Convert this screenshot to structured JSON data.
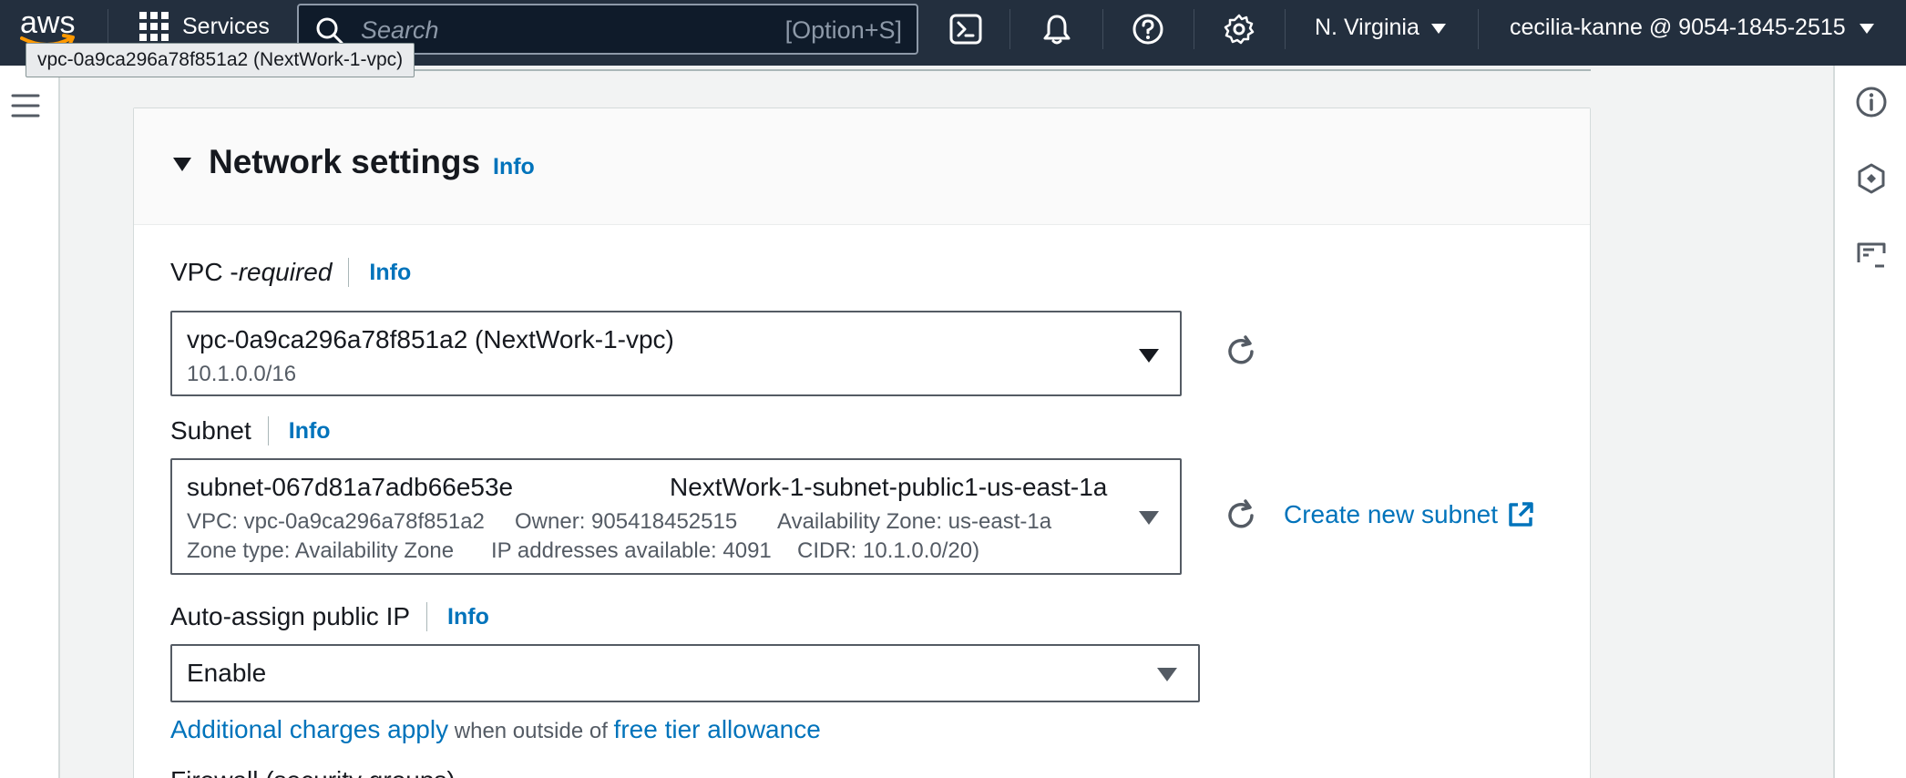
{
  "topnav": {
    "logo_text": "aws",
    "services_label": "Services",
    "search_placeholder": "Search",
    "search_shortcut": "[Option+S]",
    "region": "N. Virginia",
    "account": "cecilia-kanne @ 9054-1845-2515",
    "icons": [
      "grid-icon",
      "search-icon",
      "cloudshell-icon",
      "bell-icon",
      "help-icon",
      "gear-icon"
    ]
  },
  "tooltip": "vpc-0a9ca296a78f851a2 (NextWork-1-vpc)",
  "panel": {
    "title": "Network settings",
    "info": "Info"
  },
  "vpc": {
    "label": "VPC - ",
    "label_req": "required",
    "info": "Info",
    "value": "vpc-0a9ca296a78f851a2 (NextWork-1-vpc)",
    "cidr": "10.1.0.0/16"
  },
  "subnet": {
    "label": "Subnet",
    "info": "Info",
    "id": "subnet-067d81a7adb66e53e",
    "name": "NextWork-1-subnet-public1-us-east-1a",
    "vpc": "VPC: vpc-0a9ca296a78f851a2",
    "owner": "Owner: 905418452515",
    "az": "Availability Zone: us-east-1a",
    "zone_type": "Zone type: Availability Zone",
    "ip_available": "IP addresses available: 4091",
    "cidr": "CIDR: 10.1.0.0/20)",
    "create_link": "Create new subnet"
  },
  "public_ip": {
    "label": "Auto-assign public IP",
    "info": "Info",
    "value": "Enable",
    "charges_link": "Additional charges apply",
    "charges_mid": " when outside of ",
    "tier_link": "free tier allowance"
  },
  "firewall": {
    "label": "Firewall (security groups)"
  },
  "colors": {
    "nav_bg": "#232f3e",
    "link": "#0073bb",
    "text": "#16191f",
    "muted": "#545b64"
  }
}
